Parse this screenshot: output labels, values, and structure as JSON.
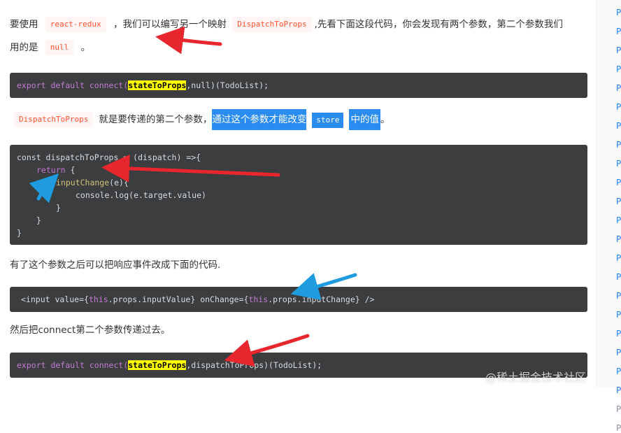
{
  "article": {
    "p1": {
      "before": "要使用",
      "code1": "react-redux",
      "mid": "，我们可以编写另一个映射",
      "code2": "DispatchToProps",
      "after": ",先看下面这段代码，你会发现有两个参数，第二个参数我们",
      "line2_before": "用的是",
      "code3": "null",
      "line2_after": "。"
    },
    "code1": {
      "pre": "export default connect(",
      "hl": "stateToProps",
      "post": ",null)(TodoList);"
    },
    "p2": {
      "code": "DispatchToProps",
      "text": "就是要传递的第二个参数，",
      "sel1": "通过这个参数才能改变",
      "sel_code": "store",
      "sel2": "中的值",
      "end": "。"
    },
    "code2": {
      "l1": "const dispatchToProps = (dispatch) =>{",
      "l2_kw": "return",
      "l2_rest": " {",
      "l3_fn": "inputChange",
      "l3_rest": "(e){",
      "l4": "console.log(e.target.value)",
      "l5": "}",
      "l6": "}",
      "l7": "}"
    },
    "p3": "有了这个参数之后可以把响应事件改成下面的代码.",
    "code3": {
      "a": "<input value={",
      "b": "this",
      "c": ".props.inputValue} onChange={",
      "d": "this",
      "e": ".props.inputChange} />"
    },
    "p4": "然后把connect第二个参数传递过去。",
    "code4": {
      "pre": "export default connect(",
      "hl": "stateToProps",
      "post": ",dispatchToProps)(TodoList);"
    }
  },
  "sidebar": {
    "items": [
      "P",
      "P",
      "P",
      "P",
      "P",
      "P",
      "P",
      "P",
      "P",
      "P",
      "P",
      "P",
      "P",
      "P",
      "P",
      "P",
      "P",
      "P",
      "P",
      "P",
      "P"
    ],
    "gray_items": [
      "P",
      "P"
    ]
  },
  "watermark": "@稀土掘金技术社区",
  "colors": {
    "code_bg": "#3b3d3e",
    "inline_code_text": "#ff502c",
    "selection": "#2a8cf0",
    "highlight": "#ffff00",
    "red_arrow": "#e8262d",
    "blue_arrow": "#1f9be0",
    "link": "#1e80ff"
  }
}
